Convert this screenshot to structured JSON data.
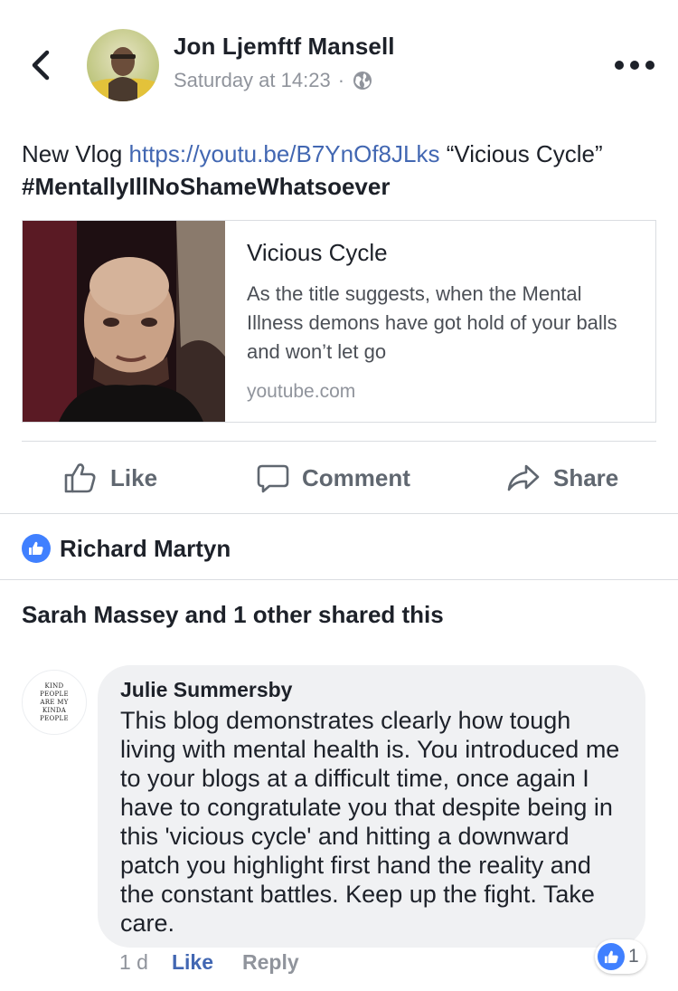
{
  "post": {
    "author": "Jon Ljemftf Mansell",
    "timestamp": "Saturday at 14:23",
    "separator": "·",
    "privacy_icon": "globe-icon",
    "text_prefix": "New Vlog ",
    "link": "https://youtu.be/B7YnOf8JLks",
    "text_suffix": " “Vicious Cycle” ",
    "hashtag": "#MentallyIllNoShameWhatsoever"
  },
  "link_card": {
    "title": "Vicious Cycle",
    "description": "As the title suggests, when the Mental Illness demons have got hold of your balls and won’t let go",
    "domain": "youtube.com"
  },
  "actions": {
    "like": "Like",
    "comment": "Comment",
    "share": "Share"
  },
  "reactions": {
    "liker": "Richard Martyn"
  },
  "shares": {
    "text": "Sarah Massey and 1 other shared this"
  },
  "comment": {
    "avatar_text": "KIND PEOPLE ARE MY KINDA PEOPLE",
    "author": "Julie Summersby",
    "text": "This blog demonstrates clearly how tough living with mental health is. You introduced me to your blogs at a difficult time, once again I have to congratulate you that despite being in this 'vicious cycle' and hitting a downward patch you highlight first hand the reality and the constant battles. Keep up the fight. Take care.",
    "time": "1 d",
    "like_label": "Like",
    "reply_label": "Reply",
    "reaction_count": "1"
  },
  "colors": {
    "link": "#4267b2",
    "like_blue": "#4080ff",
    "muted": "#90949c",
    "bubble": "#f0f1f3"
  }
}
